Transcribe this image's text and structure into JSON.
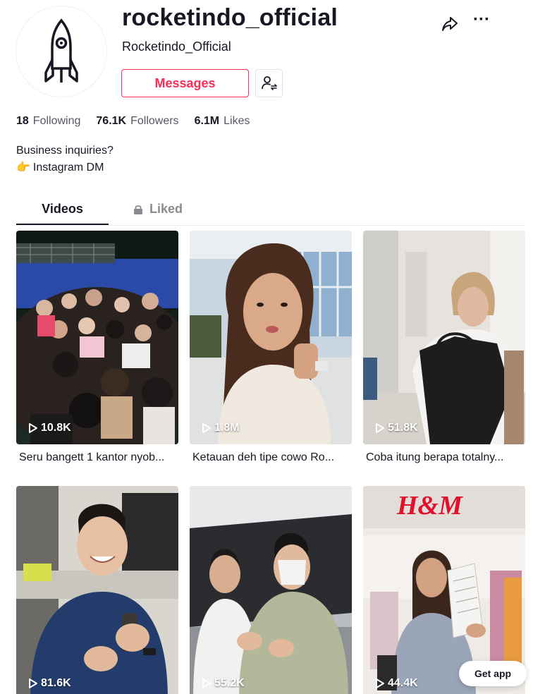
{
  "profile": {
    "username": "rocketindo_official",
    "nickname": "Rocketindo_Official",
    "messages_label": "Messages"
  },
  "stats": [
    {
      "value": "18",
      "label": "Following"
    },
    {
      "value": "76.1K",
      "label": "Followers"
    },
    {
      "value": "6.1M",
      "label": "Likes"
    }
  ],
  "bio": {
    "line1": "Business inquiries?",
    "line2": "Instagram DM",
    "line2_emoji": "👉"
  },
  "tabs": {
    "videos": "Videos",
    "liked": "Liked"
  },
  "videos": [
    {
      "views": "10.8K",
      "caption": "Seru bangett 1 kantor nyob..."
    },
    {
      "views": "1.8M",
      "caption": "Ketauan deh tipe cowo Ro..."
    },
    {
      "views": "51.8K",
      "caption": "Coba itung berapa totalny..."
    },
    {
      "views": "81.6K",
      "caption": ""
    },
    {
      "views": "55.2K",
      "caption": ""
    },
    {
      "views": "44.4K",
      "caption": ""
    }
  ],
  "thumb_texts": {
    "store_sign": "H&M"
  },
  "get_app_label": "Get app",
  "colors": {
    "accent": "#fe2c55",
    "text": "#161823",
    "muted": "#8a8b91"
  }
}
